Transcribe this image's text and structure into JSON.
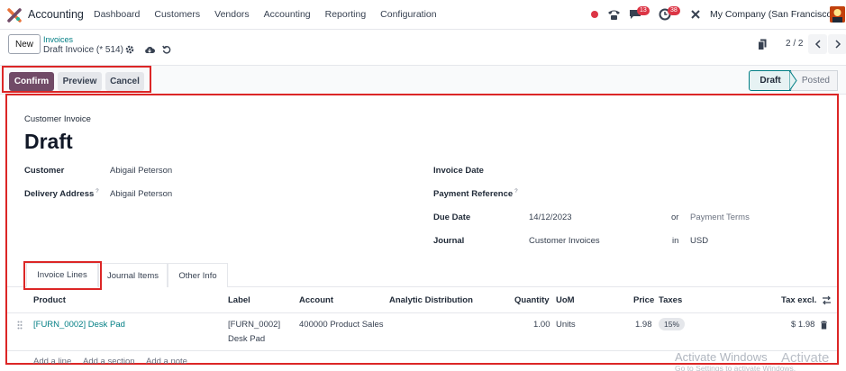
{
  "navbar": {
    "app_name": "Accounting",
    "menu": [
      "Dashboard",
      "Customers",
      "Vendors",
      "Accounting",
      "Reporting",
      "Configuration"
    ],
    "chat_badge": "13",
    "activity_badge": "38",
    "company": "My Company (San Francisco)"
  },
  "control": {
    "new_label": "New",
    "breadcrumb_parent": "Invoices",
    "breadcrumb_current": "Draft Invoice (* 514)",
    "pager": "2 / 2"
  },
  "actions": {
    "confirm": "Confirm",
    "preview": "Preview",
    "cancel": "Cancel"
  },
  "statusbar": {
    "draft": "Draft",
    "posted": "Posted"
  },
  "form": {
    "type_label": "Customer Invoice",
    "title": "Draft",
    "customer_label": "Customer",
    "customer_value": "Abigail Peterson",
    "delivery_label": "Delivery Address",
    "delivery_value": "Abigail Peterson",
    "help_mark": "?",
    "invoice_date_label": "Invoice Date",
    "payment_ref_label": "Payment Reference",
    "due_date_label": "Due Date",
    "due_date_value": "14/12/2023",
    "or_text": "or",
    "payment_terms_placeholder": "Payment Terms",
    "journal_label": "Journal",
    "journal_value": "Customer Invoices",
    "in_text": "in",
    "currency_value": "USD"
  },
  "tabs": [
    "Invoice Lines",
    "Journal Items",
    "Other Info"
  ],
  "table": {
    "headers": {
      "product": "Product",
      "label": "Label",
      "account": "Account",
      "analytic": "Analytic Distribution",
      "quantity": "Quantity",
      "uom": "UoM",
      "price": "Price",
      "taxes": "Taxes",
      "tax_excl": "Tax excl."
    },
    "rows": [
      {
        "product": "[FURN_0002] Desk Pad",
        "label_line1": "[FURN_0002]",
        "label_line2": "Desk Pad",
        "account": "400000 Product Sales",
        "quantity": "1.00",
        "uom": "Units",
        "price": "1.98",
        "tax": "15%",
        "subtotal": "$ 1.98"
      }
    ],
    "add_line": "Add a line",
    "add_section": "Add a section",
    "add_note": "Add a note"
  },
  "watermark": {
    "line1": "Activate Windows",
    "line1b": "Activate",
    "line2": "Go to Settings to activate Windows."
  }
}
